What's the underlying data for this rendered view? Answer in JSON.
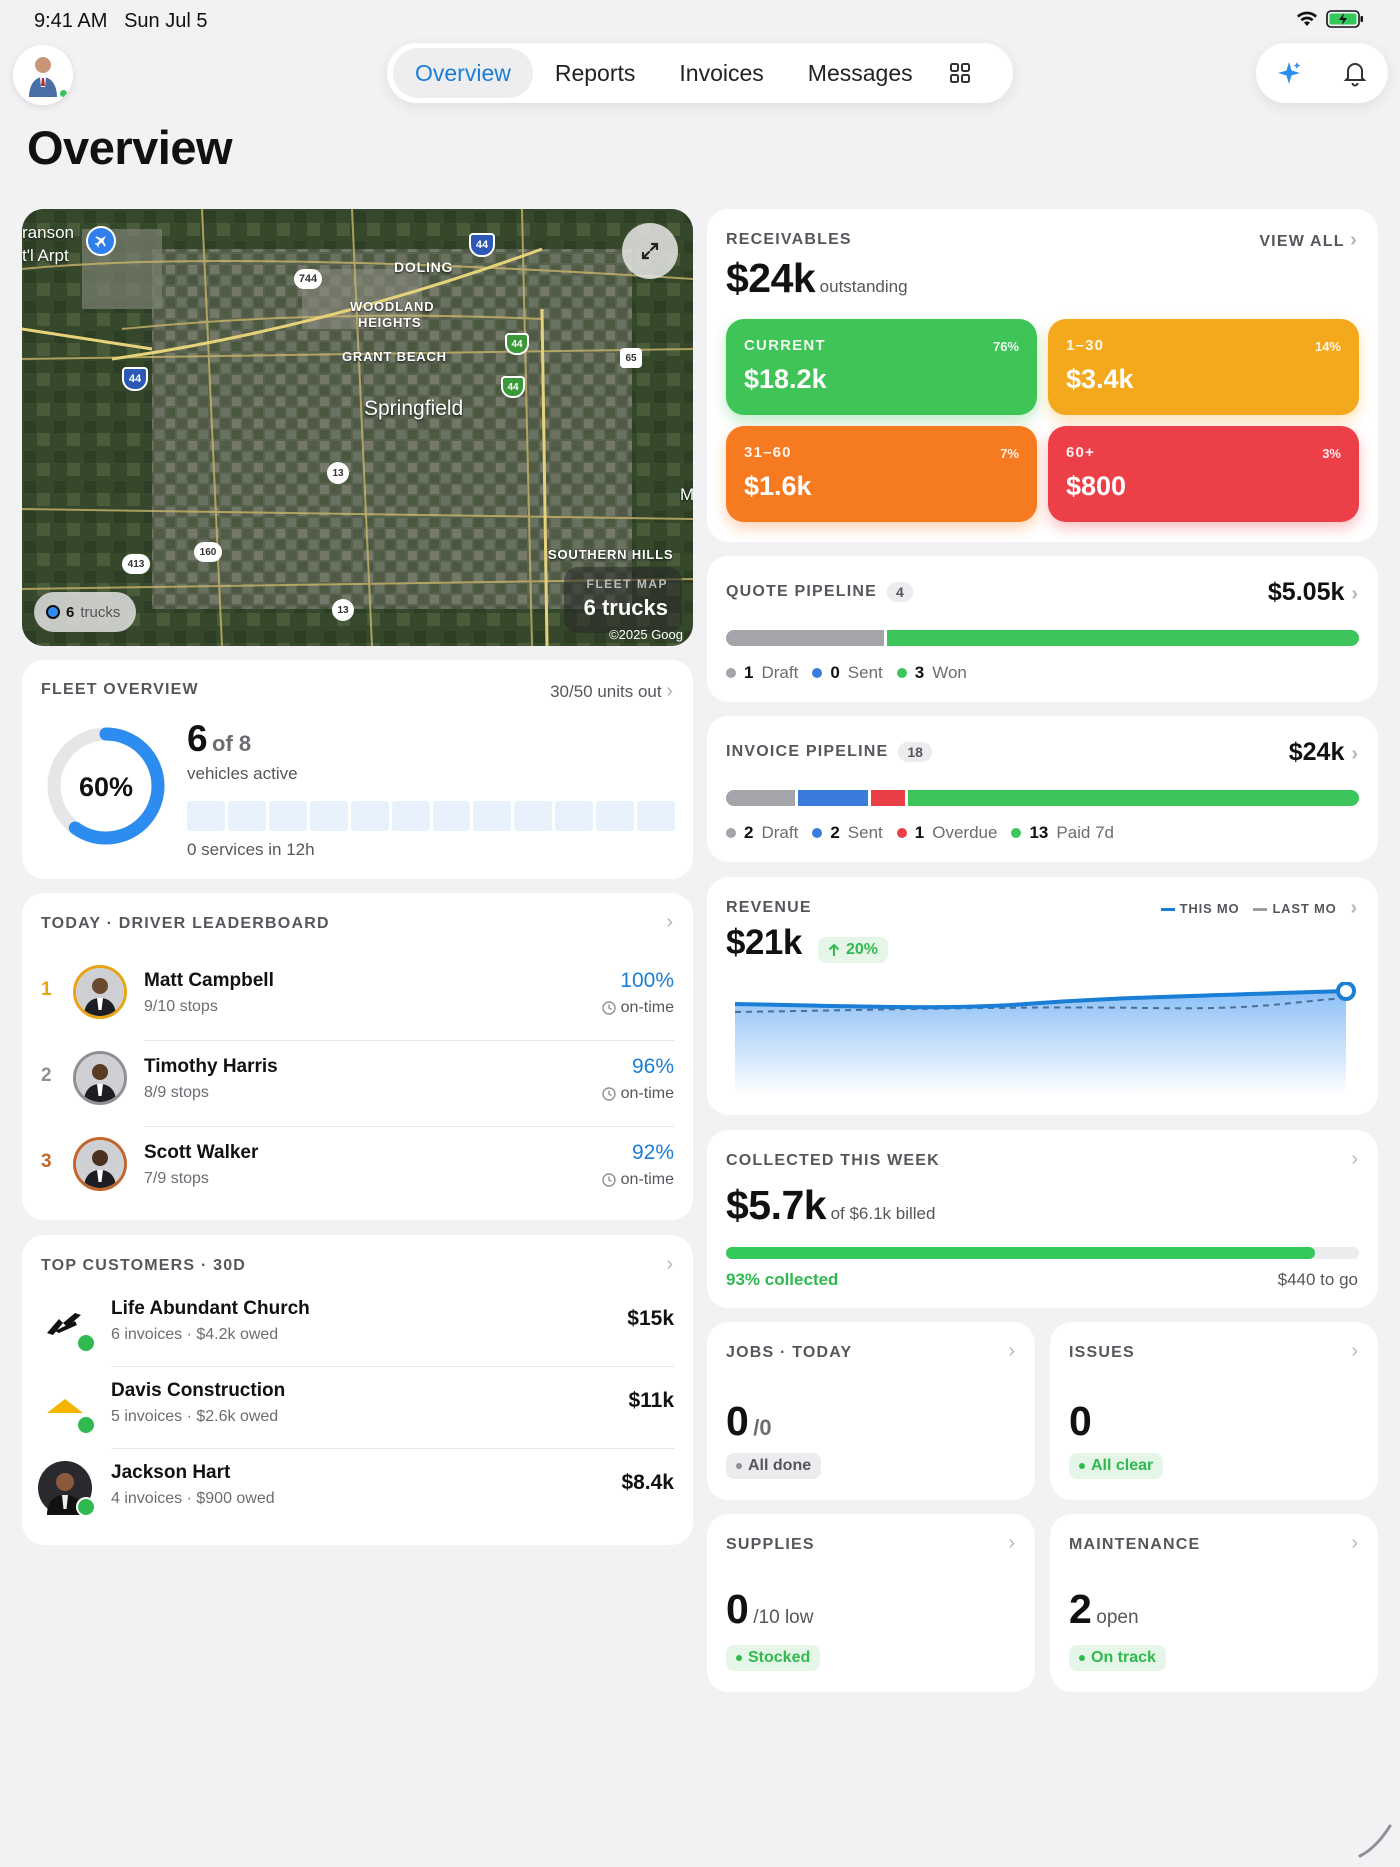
{
  "status": {
    "time": "9:41 AM",
    "date": "Sun Jul 5"
  },
  "nav": {
    "tabs": [
      "Overview",
      "Reports",
      "Invoices",
      "Messages"
    ],
    "active": "Overview"
  },
  "page_title": "Overview",
  "map": {
    "places": [
      "ranson",
      "t'l Arpt",
      "DOLING",
      "WOODLAND",
      "HEIGHTS",
      "GRANT BEACH",
      "Springfield",
      "SOUTHERN HILLS",
      "M"
    ],
    "shields": [
      "44",
      "744",
      "44",
      "44",
      "65",
      "44",
      "13",
      "160",
      "413",
      "13"
    ],
    "trucks_chip": {
      "count": "6",
      "label": "trucks"
    },
    "fleet_map_label": "FLEET MAP",
    "fleet_map_value": "6 trucks",
    "copyright": "©2025 Goog"
  },
  "fleet": {
    "title": "FLEET OVERVIEW",
    "units": "30/50 units out",
    "percent": "60%",
    "percent_value": 60,
    "active": "6",
    "of": "of 8",
    "active_label": "vehicles active",
    "services": "0 services in 12h"
  },
  "leaderboard": {
    "title": "TODAY · DRIVER LEADERBOARD",
    "drivers": [
      {
        "rank": "1",
        "name": "Matt Campbell",
        "stops": "9/10 stops",
        "pct": "100%",
        "ontime": "on-time",
        "ring": "#e8a317",
        "rank_color": "#e8a317"
      },
      {
        "rank": "2",
        "name": "Timothy Harris",
        "stops": "8/9 stops",
        "pct": "96%",
        "ontime": "on-time",
        "ring": "#8e9096",
        "rank_color": "#8e9096"
      },
      {
        "rank": "3",
        "name": "Scott Walker",
        "stops": "7/9 stops",
        "pct": "92%",
        "ontime": "on-time",
        "ring": "#c0662a",
        "rank_color": "#c0662a"
      }
    ]
  },
  "customers": {
    "title": "TOP CUSTOMERS · 30D",
    "items": [
      {
        "name": "Life Abundant Church",
        "meta": "6 invoices · $4.2k owed",
        "amount": "$15k"
      },
      {
        "name": "Davis Construction",
        "meta": "5 invoices · $2.6k owed",
        "amount": "$11k"
      },
      {
        "name": "Jackson Hart",
        "meta": "4 invoices · $900 owed",
        "amount": "$8.4k"
      }
    ]
  },
  "receivables": {
    "title": "RECEIVABLES",
    "view_all": "VIEW ALL",
    "total": "$24k",
    "total_label": "outstanding",
    "buckets": [
      {
        "label": "CURRENT",
        "pct": "76%",
        "value": "$18.2k",
        "color": "#3fc457"
      },
      {
        "label": "1–30",
        "pct": "14%",
        "value": "$3.4k",
        "color": "#f4a91c"
      },
      {
        "label": "31–60",
        "pct": "7%",
        "value": "$1.6k",
        "color": "#f67a1f"
      },
      {
        "label": "60+",
        "pct": "3%",
        "value": "$800",
        "color": "#ec3f48"
      }
    ]
  },
  "quote": {
    "title": "QUOTE PIPELINE",
    "count": "4",
    "total": "$5.05k",
    "legend": [
      {
        "n": "1",
        "label": "Draft",
        "color": "#a3a5aa"
      },
      {
        "n": "0",
        "label": "Sent",
        "color": "#3a7bdc"
      },
      {
        "n": "3",
        "label": "Won",
        "color": "#3cc55a"
      }
    ],
    "segments": [
      1,
      0,
      3
    ]
  },
  "invoice": {
    "title": "INVOICE PIPELINE",
    "count": "18",
    "total": "$24k",
    "legend": [
      {
        "n": "2",
        "label": "Draft",
        "color": "#a3a5aa"
      },
      {
        "n": "2",
        "label": "Sent",
        "color": "#3a7bdc"
      },
      {
        "n": "1",
        "label": "Overdue",
        "color": "#e84046"
      },
      {
        "n": "13",
        "label": "Paid 7d",
        "color": "#3cc55a"
      }
    ],
    "segments": [
      2,
      2,
      1,
      13
    ]
  },
  "revenue": {
    "title": "REVENUE",
    "value": "$21k",
    "change": "20%",
    "legend_this": "THIS MO",
    "legend_last": "LAST MO"
  },
  "collected": {
    "title": "COLLECTED THIS WEEK",
    "value": "$5.7k",
    "of": "of $6.1k billed",
    "pct_label": "93% collected",
    "pct_value": 93,
    "to_go": "$440 to go"
  },
  "jobs": {
    "title": "JOBS · TODAY",
    "value": "0",
    "sub": "/0",
    "badge": "All done"
  },
  "issues": {
    "title": "ISSUES",
    "value": "0",
    "badge": "All clear"
  },
  "supplies": {
    "title": "SUPPLIES",
    "value": "0",
    "sub": "/10 low",
    "badge": "Stocked"
  },
  "maintenance": {
    "title": "MAINTENANCE",
    "value": "2",
    "sub": "open",
    "badge": "On track"
  },
  "colors": {
    "accent": "#1a7ed6",
    "green": "#2fb94e",
    "bg": "#f2f2f4"
  }
}
